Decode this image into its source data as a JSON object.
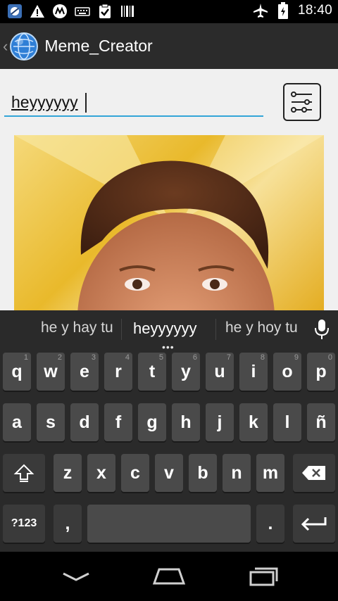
{
  "status_bar": {
    "time": "18:40",
    "left_icons": [
      "app-notification-icon",
      "warning-icon",
      "motorola-icon",
      "keyboard-icon",
      "clipboard-check-icon",
      "barcode-icon"
    ],
    "right_icons": [
      "airplane-mode-icon",
      "battery-icon"
    ]
  },
  "action_bar": {
    "title": "Meme_Creator",
    "icon": "globe-app-icon"
  },
  "editor": {
    "text_value": "heyyyyyy",
    "settings_icon": "sliders-icon"
  },
  "keyboard": {
    "suggestions": [
      "he y hay tu",
      "heyyyyyy",
      "he y hoy tu"
    ],
    "suggestion_more": "•••",
    "rows": [
      [
        {
          "k": "q",
          "h": "1"
        },
        {
          "k": "w",
          "h": "2"
        },
        {
          "k": "e",
          "h": "3"
        },
        {
          "k": "r",
          "h": "4"
        },
        {
          "k": "t",
          "h": "5"
        },
        {
          "k": "y",
          "h": "6"
        },
        {
          "k": "u",
          "h": "7"
        },
        {
          "k": "i",
          "h": "8"
        },
        {
          "k": "o",
          "h": "9"
        },
        {
          "k": "p",
          "h": "0"
        }
      ],
      [
        {
          "k": "a"
        },
        {
          "k": "s"
        },
        {
          "k": "d"
        },
        {
          "k": "f"
        },
        {
          "k": "g"
        },
        {
          "k": "h"
        },
        {
          "k": "j"
        },
        {
          "k": "k"
        },
        {
          "k": "l"
        },
        {
          "k": "ñ"
        }
      ],
      [
        {
          "k": "z"
        },
        {
          "k": "x"
        },
        {
          "k": "c"
        },
        {
          "k": "v"
        },
        {
          "k": "b"
        },
        {
          "k": "n"
        },
        {
          "k": "m"
        }
      ]
    ],
    "symbols_label": "?123",
    "comma": ",",
    "period": "."
  },
  "colors": {
    "accent": "#33a5d8",
    "action_bar": "#2b2b2b",
    "keyboard_bg": "#2a2a2a",
    "key_bg": "#4a4a4a"
  }
}
